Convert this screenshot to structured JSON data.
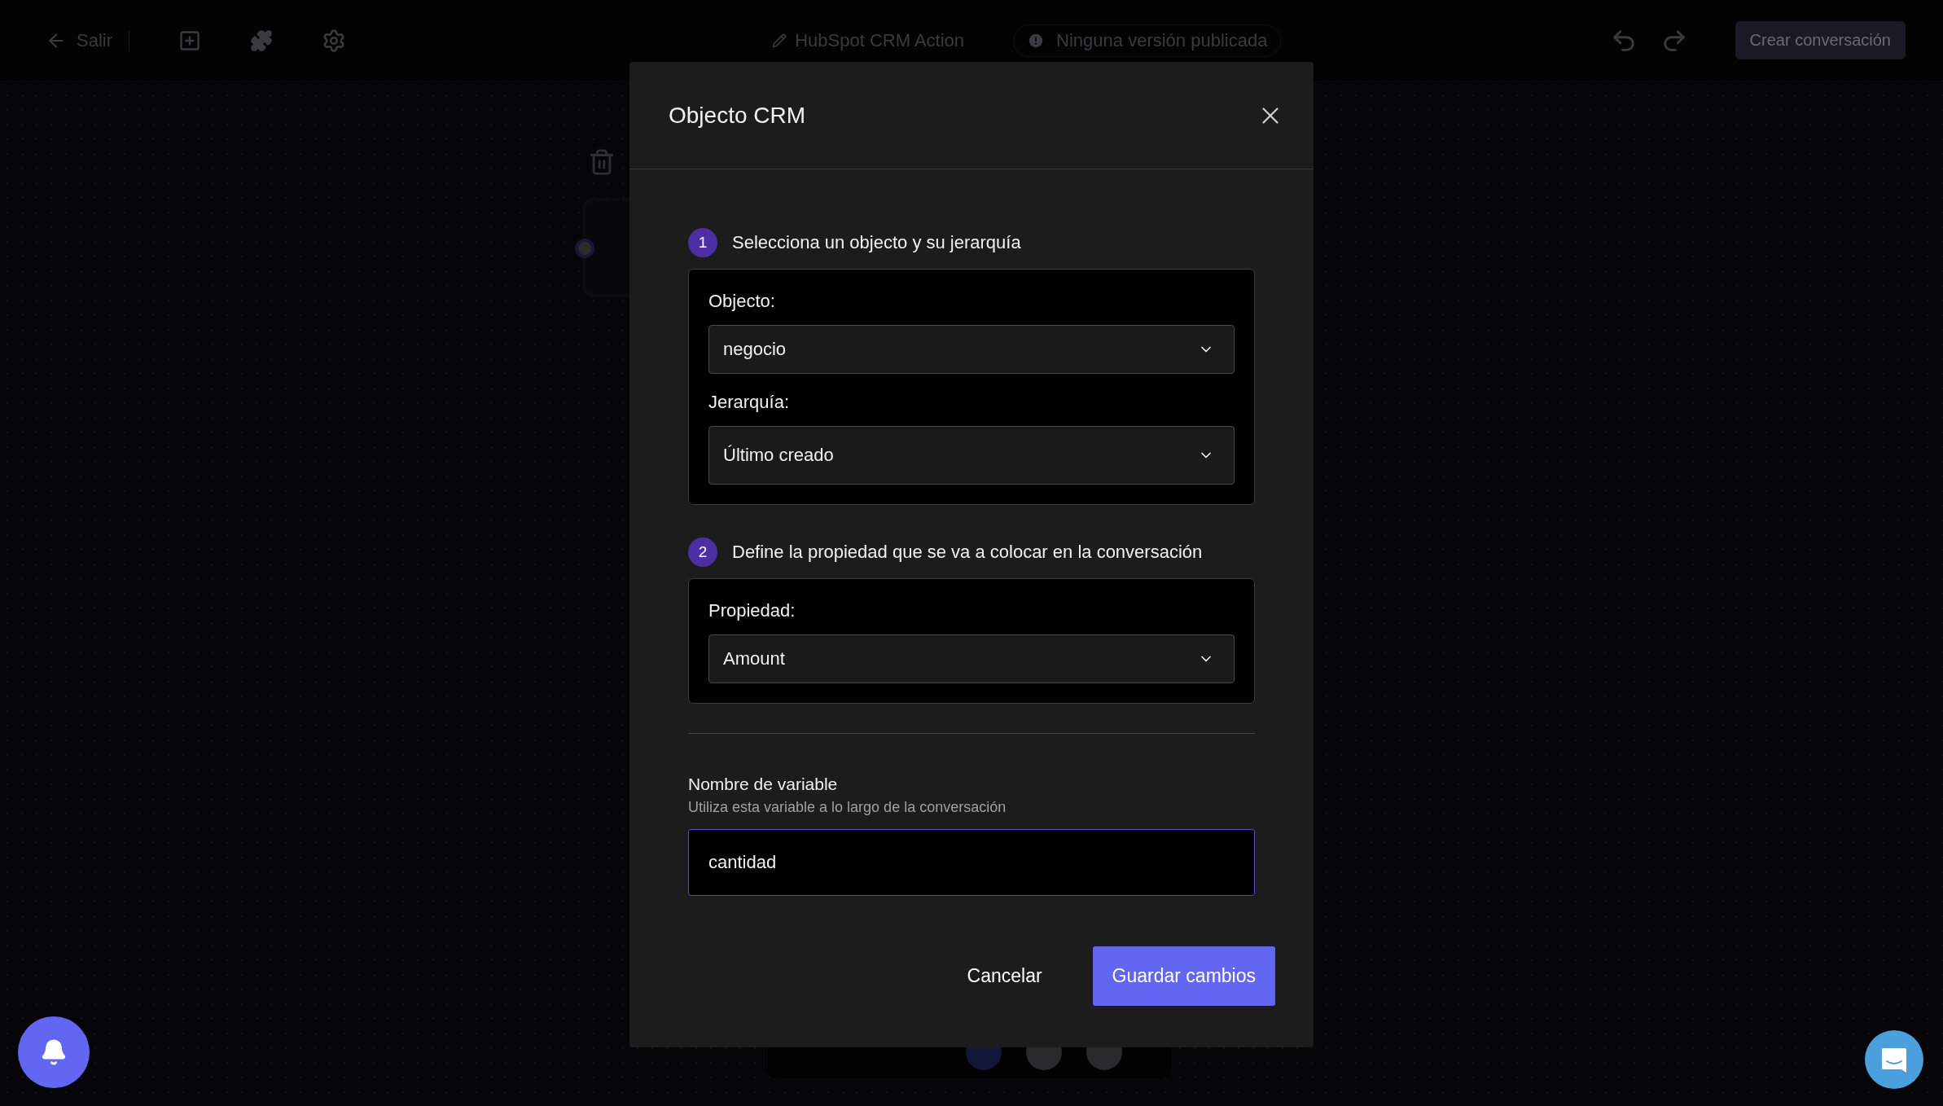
{
  "top_bar": {
    "back_label": "Salir",
    "flow_name": "HubSpot CRM Action",
    "status": "Ninguna versión publicada",
    "primary_button": "Crear conversación"
  },
  "dialog": {
    "title": "Objecto CRM",
    "steps": [
      {
        "number": "1",
        "title": "Selecciona un objecto y su jerarquía",
        "fields": [
          {
            "label": "Objecto:",
            "value": "negocio"
          },
          {
            "label": "Jerarquía:",
            "value": "Último creado"
          }
        ]
      },
      {
        "number": "2",
        "title": "Define la propiedad que se va a colocar en la conversación",
        "fields": [
          {
            "label": "Propiedad:",
            "value": "Amount"
          }
        ]
      }
    ],
    "variable": {
      "label": "Nombre de variable",
      "hint": "Utiliza esta variable a lo largo de la conversación",
      "value": "cantidad",
      "focused": true
    },
    "buttons": [
      {
        "label": "Cancelar",
        "kind": "secondary"
      },
      {
        "label": "Guardar cambios",
        "kind": "primary"
      }
    ]
  }
}
